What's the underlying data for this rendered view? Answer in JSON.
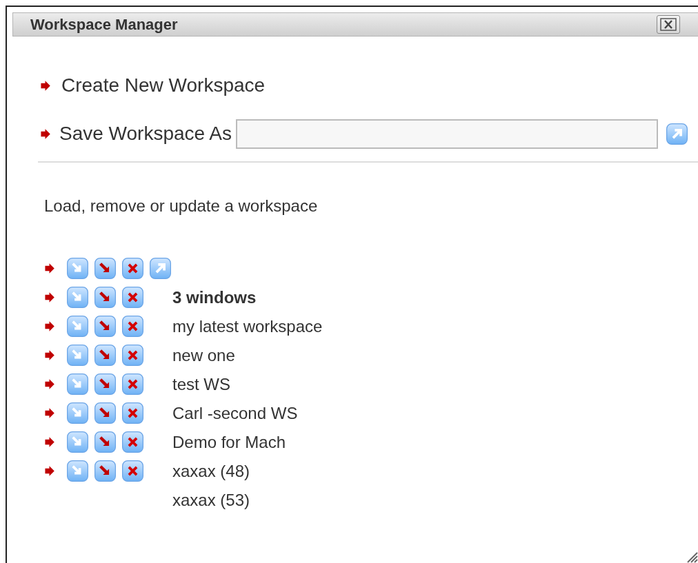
{
  "window": {
    "title": "Workspace Manager"
  },
  "create": {
    "label": "Create New Workspace"
  },
  "save": {
    "label": "Save Workspace As"
  },
  "section_label": "Load, remove or update a workspace",
  "rows": [
    {
      "kind": "header"
    },
    {
      "kind": "workspace",
      "name": "3 windows",
      "current": true
    },
    {
      "kind": "workspace",
      "name": "my latest workspace",
      "current": false
    },
    {
      "kind": "workspace",
      "name": "new one",
      "current": false
    },
    {
      "kind": "workspace",
      "name": "test WS",
      "current": false
    },
    {
      "kind": "workspace",
      "name": "Carl -second WS",
      "current": false
    },
    {
      "kind": "workspace",
      "name": "Demo for Mach",
      "current": false
    },
    {
      "kind": "workspace",
      "name": "xaxax (48)",
      "current": false
    },
    {
      "kind": "plain",
      "name": "xaxax (53)",
      "current": false
    }
  ]
}
